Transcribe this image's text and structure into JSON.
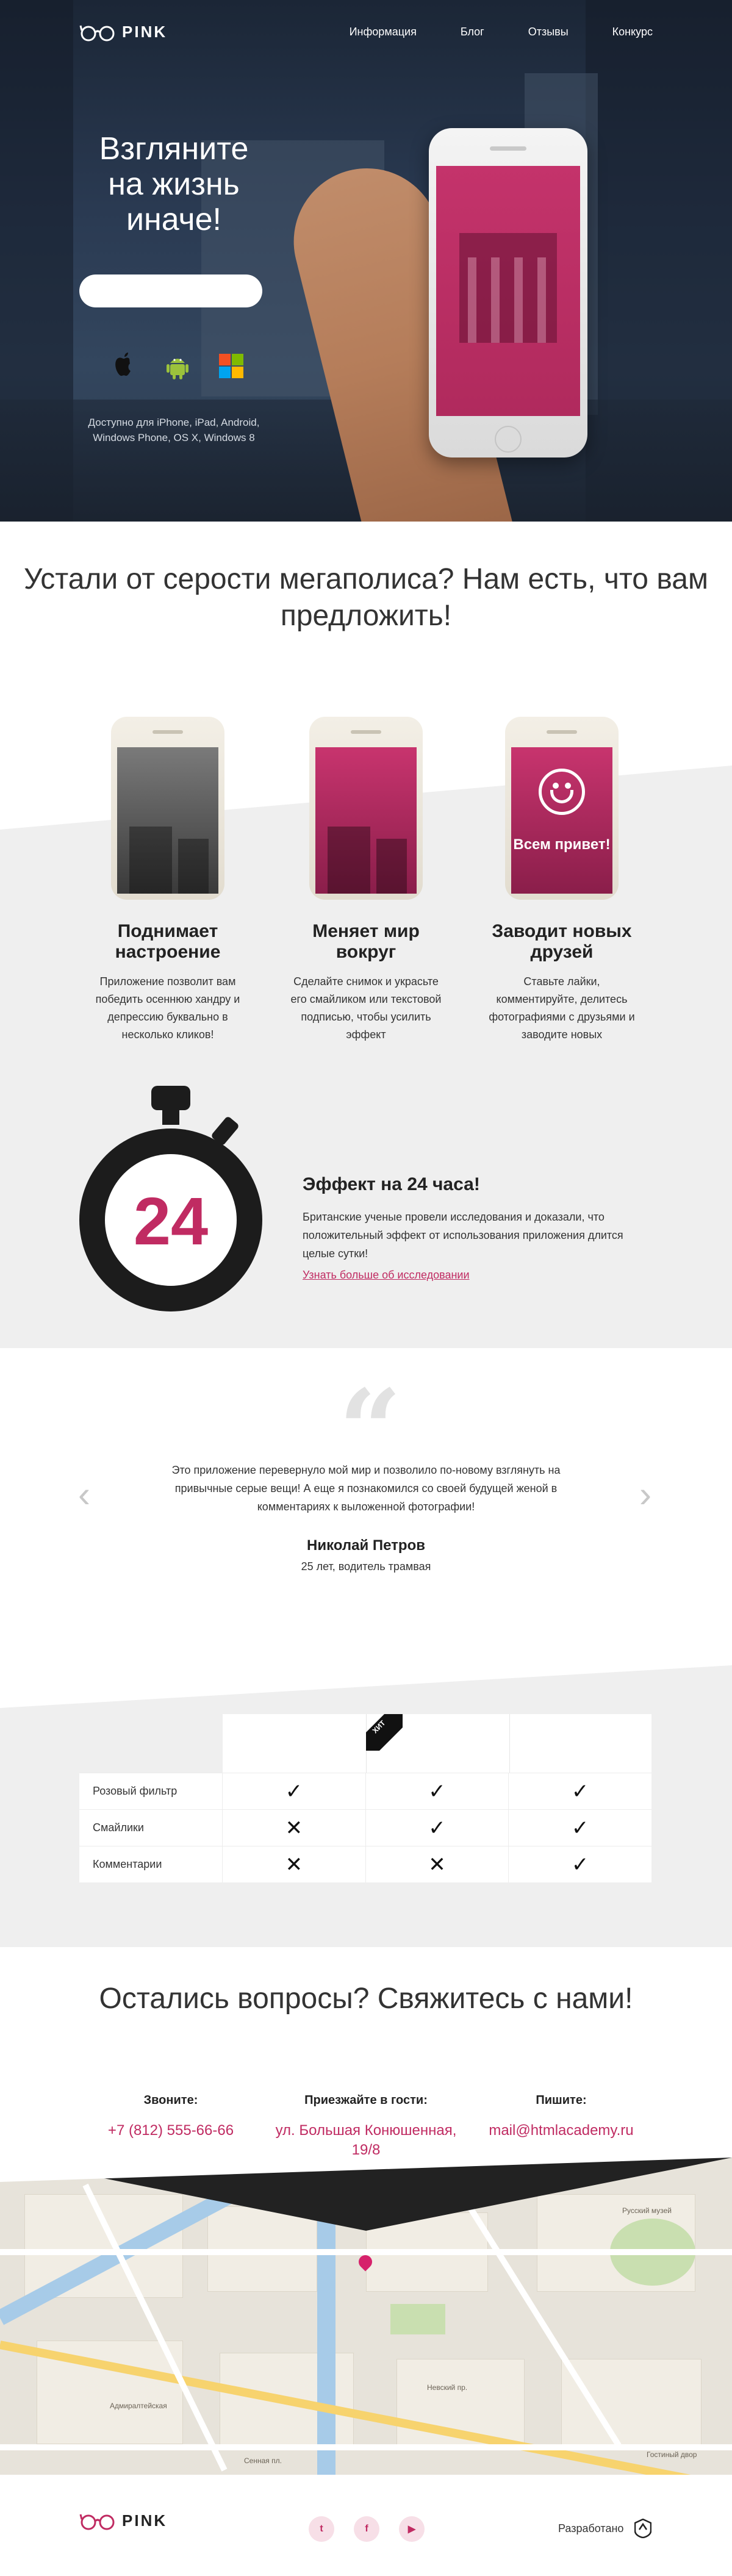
{
  "brand": {
    "logo_text": "PINK"
  },
  "nav": [
    {
      "label": "Информация"
    },
    {
      "label": "Блог"
    },
    {
      "label": "Отзывы"
    },
    {
      "label": "Конкурс"
    }
  ],
  "hero": {
    "title": "Взгляните на жизнь иначе!",
    "input_placeholder": "",
    "os_icons": [
      "apple-icon",
      "android-icon",
      "windows-icon"
    ],
    "availability": "Доступно для iPhone, iPad, Android, Windows Phone, OS X, Windows 8"
  },
  "features": {
    "title": "Устали от серости мегаполиса? Нам есть, что вам предложить!",
    "phone3_text": "Всем привет!",
    "items": [
      {
        "heading": "Поднимает настроение",
        "text": "Приложение позволит вам победить осеннюю хандру и депрессию буквально в несколько кликов!"
      },
      {
        "heading": "Меняет мир вокруг",
        "text": "Сделайте снимок и украсьте его смайликом или текстовой подписью, чтобы усилить эффект"
      },
      {
        "heading": "Заводит новых друзей",
        "text": "Ставьте лайки, комментируйте, делитесь фотографиями с друзьями и заводите новых"
      }
    ],
    "effect": {
      "timer_value": "24",
      "title": "Эффект на 24 часа!",
      "text": "Британские ученые провели исследования и доказали, что положительный эффект от использования приложения длится целые сутки!",
      "link": "Узнать больше об исследовании"
    }
  },
  "review": {
    "quote_mark": "“",
    "text": "Это приложение перевернуло мой мир и позволило по-новому взглянуть на привычные серые вещи! А еще я познакомился со своей будущей женой в комментариях к выложенной фотографии!",
    "name": "Николай Петров",
    "role": "25 лет, водитель трамвая",
    "prev": "‹",
    "next": "›"
  },
  "pricing": {
    "badge": "ХИТ",
    "rows": [
      {
        "label": "Розовый фильтр",
        "cells": [
          "✓",
          "✓",
          "✓"
        ]
      },
      {
        "label": "Смайлики",
        "cells": [
          "✕",
          "✓",
          "✓"
        ]
      },
      {
        "label": "Комментарии",
        "cells": [
          "✕",
          "✕",
          "✓"
        ]
      }
    ]
  },
  "contacts": {
    "title": "Остались вопросы? Свяжитесь с нами!",
    "columns": [
      {
        "heading": "Звоните:",
        "value": "+7 (812) 555-66-66"
      },
      {
        "heading": "Приезжайте в гости:",
        "value": "ул. Большая Конюшенная, 19/8"
      },
      {
        "heading": "Пишите:",
        "value": "mail@htmlacademy.ru"
      }
    ]
  },
  "map": {
    "labels": [
      "Русский музей",
      "Невский пр.",
      "Адмиралтейская",
      "Гостиный двор",
      "Сенная пл."
    ]
  },
  "footer": {
    "logo_text": "PINK",
    "social": [
      "twitter-icon",
      "facebook-icon",
      "youtube-icon"
    ],
    "social_glyphs": [
      "t",
      "f",
      "▶"
    ],
    "made_by": "Разработано"
  },
  "colors": {
    "accent": "#c02b62",
    "dark": "#222222",
    "bg_gray": "#efefef"
  }
}
